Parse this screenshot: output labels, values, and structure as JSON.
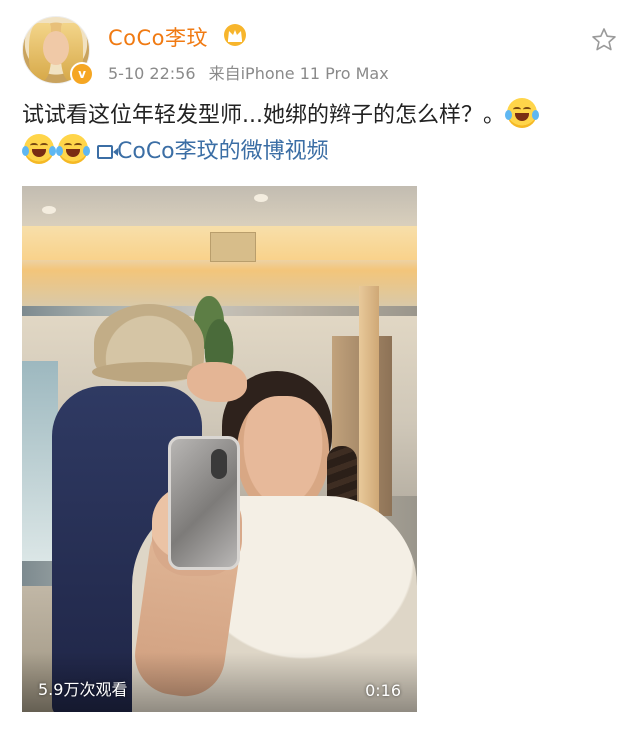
{
  "post": {
    "author": {
      "name": "CoCo李玟",
      "verified_badge": "v",
      "crown_icon": "crown-icon"
    },
    "meta": {
      "timestamp": "5-10 22:56",
      "source": "来自iPhone 11 Pro Max"
    },
    "favorite_icon": "star-icon",
    "text_main": "试试看这位年轻发型师...她绑的辫子的怎么样？。",
    "emoji_name": "laugh-cry-emoji",
    "video_link": {
      "label": "CoCo李玟的微博视频",
      "icon": "video-icon"
    },
    "video": {
      "views": "5.9万次观看",
      "duration": "0:16"
    }
  },
  "colors": {
    "username": "#f07a12",
    "link": "#3b6ea5",
    "meta": "#8a8a8a",
    "badge": "#f5a623"
  }
}
